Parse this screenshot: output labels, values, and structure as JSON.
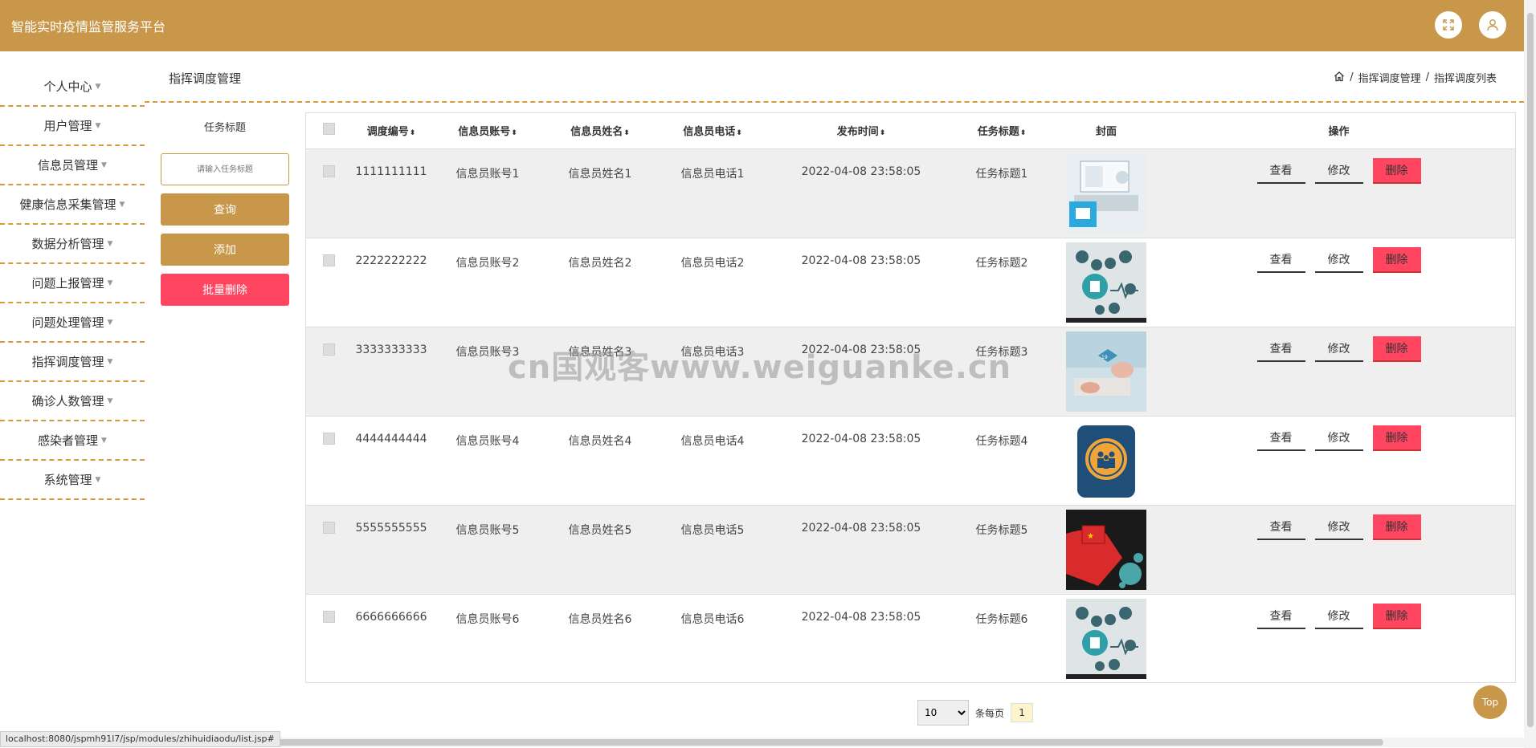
{
  "header": {
    "title": "智能实时疫情监管服务平台",
    "fullscreen_icon": "fullscreen-icon",
    "user_icon": "user-icon"
  },
  "sidebar": {
    "items": [
      {
        "label": "个人中心"
      },
      {
        "label": "用户管理"
      },
      {
        "label": "信息员管理"
      },
      {
        "label": "健康信息采集管理"
      },
      {
        "label": "数据分析管理"
      },
      {
        "label": "问题上报管理"
      },
      {
        "label": "问题处理管理"
      },
      {
        "label": "指挥调度管理"
      },
      {
        "label": "确诊人数管理"
      },
      {
        "label": "感染者管理"
      },
      {
        "label": "系统管理"
      }
    ]
  },
  "page": {
    "title": "指挥调度管理",
    "breadcrumb": [
      "指挥调度管理",
      "指挥调度列表"
    ]
  },
  "filter": {
    "label": "任务标题",
    "placeholder": "请输入任务标题",
    "query_label": "查询",
    "add_label": "添加",
    "batch_delete_label": "批量删除"
  },
  "table": {
    "columns": [
      "调度编号",
      "信息员账号",
      "信息员姓名",
      "信息员电话",
      "发布时间",
      "任务标题",
      "封面",
      "操作"
    ],
    "rows": [
      {
        "id": "1111111111",
        "account": "信息员账号1",
        "name": "信息员姓名1",
        "phone": "信息员电话1",
        "time": "2022-04-08 23:58:05",
        "task": "任务标题1",
        "cover": "medical-laptop-image"
      },
      {
        "id": "2222222222",
        "account": "信息员账号2",
        "name": "信息员姓名2",
        "phone": "信息员电话2",
        "time": "2022-04-08 23:58:05",
        "task": "任务标题2",
        "cover": "medical-icons-image"
      },
      {
        "id": "3333333333",
        "account": "信息员账号3",
        "name": "信息员姓名3",
        "phone": "信息员电话3",
        "time": "2022-04-08 23:58:05",
        "task": "任务标题3",
        "cover": "covid-hand-image"
      },
      {
        "id": "4444444444",
        "account": "信息员账号4",
        "name": "信息员姓名4",
        "phone": "信息员电话4",
        "time": "2022-04-08 23:58:05",
        "task": "任务标题4",
        "cover": "people-badge-image"
      },
      {
        "id": "5555555555",
        "account": "信息员账号5",
        "name": "信息员姓名5",
        "phone": "信息员电话5",
        "time": "2022-04-08 23:58:05",
        "task": "任务标题5",
        "cover": "fist-virus-image"
      },
      {
        "id": "6666666666",
        "account": "信息员账号6",
        "name": "信息员姓名6",
        "phone": "信息员电话6",
        "time": "2022-04-08 23:58:05",
        "task": "任务标题6",
        "cover": "medical-icons-image"
      }
    ],
    "actions": {
      "view": "查看",
      "edit": "修改",
      "delete": "删除"
    }
  },
  "pager": {
    "page_size": "10",
    "per_page_label": "条每页",
    "current_page": "1"
  },
  "watermark": "cn国观客www.weiguanke.cn",
  "top_button": "Top",
  "status_url": "localhost:8080/jspmh91l7/jsp/modules/zhihuidiaodu/list.jsp#",
  "colors": {
    "accent": "#c9974a",
    "danger": "#ff4560",
    "dashed": "#d49a3c"
  }
}
